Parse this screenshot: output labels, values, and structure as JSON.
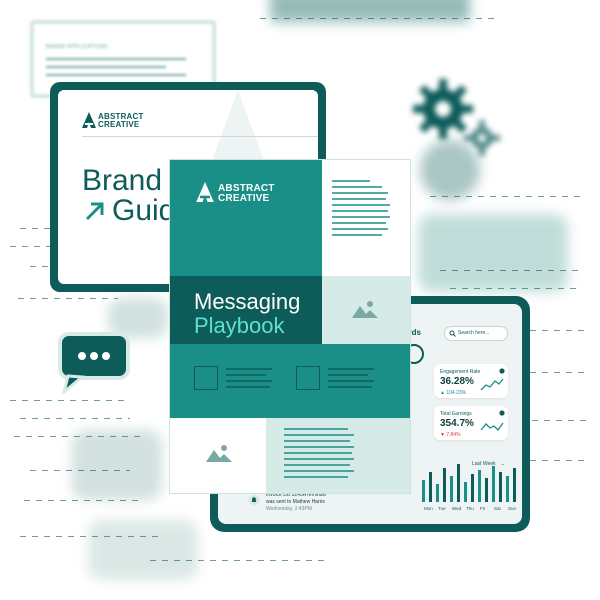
{
  "brand_card": {
    "logo_line1": "ABSTRACT",
    "logo_line2": "CREATIVE",
    "title_line1": "Brand",
    "title_line2": "Guid"
  },
  "top_card": {
    "label": "BRAND APPLICATIONS"
  },
  "playbook": {
    "logo_line1": "ABSTRACT",
    "logo_line2": "CREATIVE",
    "title": "Messaging",
    "subtitle": "Playbook"
  },
  "dashboard": {
    "heading_fragment": "ards",
    "search_placeholder": "Search here...",
    "engagement": {
      "label": "Engagement Rate",
      "value": "36.28%",
      "delta": "104.23%"
    },
    "earnings": {
      "label": "Total Earnings",
      "value": "354.7%",
      "delta": "7.84%"
    },
    "range_label": "Last Week",
    "days": [
      "Mon",
      "Tue",
      "Wed",
      "Thu",
      "Fri",
      "Sat",
      "Sun"
    ],
    "notification": {
      "line1": "Invoice DB 3145A reminder",
      "line2": "was sent to Mathew Harris",
      "line3": "Wednesday, 2:43PM"
    }
  },
  "colors": {
    "teal_dark": "#0d5c5a",
    "teal": "#1a8f87",
    "mint": "#d6ebe7",
    "accent_cyan": "#5fe0cf",
    "up": "#1a8f87",
    "down": "#d9393e"
  }
}
